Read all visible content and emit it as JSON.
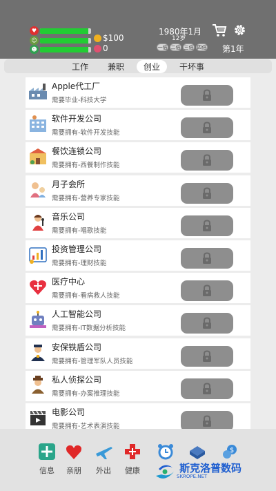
{
  "header": {
    "stats": [
      {
        "name": "health",
        "value": 0.95
      },
      {
        "name": "spirit",
        "value": 0.95
      },
      {
        "name": "happiness",
        "value": 0.95
      }
    ],
    "money": "$100",
    "charm": "0",
    "date": "1980年1月",
    "age": "12岁",
    "speed_buttons": [
      "一倍",
      "二倍",
      "三倍",
      "四倍"
    ],
    "year_label": "第1年"
  },
  "tabs": [
    "工作",
    "兼职",
    "创业",
    "干坏事"
  ],
  "active_tab": "创业",
  "companies": [
    {
      "name": "Apple代工厂",
      "requirement": "需要毕业-科技大学",
      "icon": "factory-icon"
    },
    {
      "name": "软件开发公司",
      "requirement": "需要拥有-软件开发技能",
      "icon": "office-building-icon"
    },
    {
      "name": "餐饮连锁公司",
      "requirement": "需要拥有-西餐制作技能",
      "icon": "restaurant-icon"
    },
    {
      "name": "月子会所",
      "requirement": "需要拥有-营养专家技能",
      "icon": "mother-baby-icon"
    },
    {
      "name": "音乐公司",
      "requirement": "需要拥有-唱歌技能",
      "icon": "singer-icon"
    },
    {
      "name": "投资管理公司",
      "requirement": "需要拥有-理财技能",
      "icon": "investment-chart-icon"
    },
    {
      "name": "医疗中心",
      "requirement": "需要拥有-看病救人技能",
      "icon": "heart-care-icon"
    },
    {
      "name": "人工智能公司",
      "requirement": "需要拥有-IT数据分析技能",
      "icon": "robot-icon"
    },
    {
      "name": "安保铁盾公司",
      "requirement": "需要拥有-管理军队人员技能",
      "icon": "security-guard-icon"
    },
    {
      "name": "私人侦探公司",
      "requirement": "需要拥有-办案推理技能",
      "icon": "detective-icon"
    },
    {
      "name": "电影公司",
      "requirement": "需要拥有-艺术表演技能",
      "icon": "film-clapper-icon"
    }
  ],
  "bottom_nav": [
    {
      "label": "信息",
      "icon": "info-cross-icon"
    },
    {
      "label": "亲朋",
      "icon": "heart-icon"
    },
    {
      "label": "外出",
      "icon": "airplane-icon"
    },
    {
      "label": "健康",
      "icon": "medical-cross-icon"
    },
    {
      "label": "",
      "icon": "alarm-clock-icon"
    },
    {
      "label": "",
      "icon": "book-stack-icon"
    },
    {
      "label": "",
      "icon": "money-icon"
    }
  ],
  "watermark": {
    "text": "斯克洛普数码",
    "sub": "SKROPE.NET"
  },
  "colors": {
    "header": "#707070",
    "bar_fill": "#22cc33",
    "lock_button": "#8e8e8e",
    "watermark": "#1f5fd0"
  }
}
